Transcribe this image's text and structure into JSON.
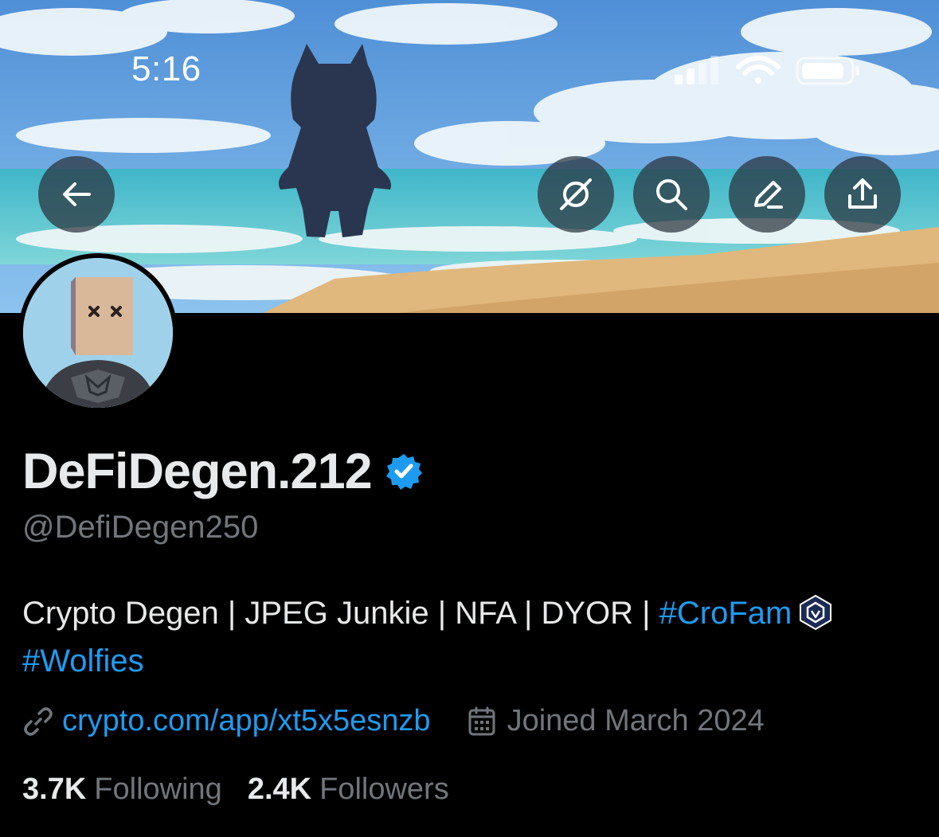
{
  "status_bar": {
    "time": "5:16"
  },
  "header_actions": [
    {
      "name": "grok-icon"
    },
    {
      "name": "search-icon"
    },
    {
      "name": "edit-icon"
    },
    {
      "name": "share-icon"
    }
  ],
  "profile": {
    "display_name": "DeFiDegen.212",
    "verified": true,
    "handle": "@DefiDegen250",
    "bio": {
      "text": "Crypto Degen | JPEG Junkie | NFA | DYOR | ",
      "tag1": "#CroFam",
      "tag2": "#Wolfies"
    },
    "link": "crypto.com/app/xt5x5esnzb",
    "joined": "Joined March 2024",
    "following_count": "3.7K",
    "following_label": "Following",
    "followers_count": "2.4K",
    "followers_label": "Followers"
  },
  "colors": {
    "background": "#000000",
    "primary_text": "#e7e9ea",
    "secondary_text": "#71767b",
    "accent": "#1d9bf0"
  }
}
